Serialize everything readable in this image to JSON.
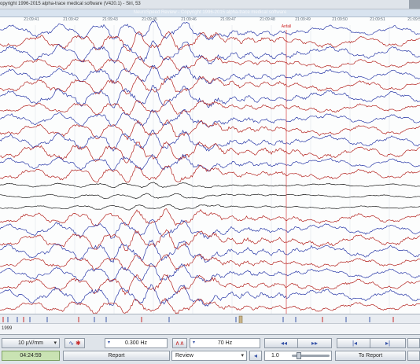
{
  "window": {
    "title": "opyright 1996-2015 alpha-trace medical software (V420.1) - Siri, 53"
  },
  "review_header": {
    "title": "NeuroSpeed Review - Copyright 1996-2015 alpha-trace medical software"
  },
  "time_axis": {
    "ticks": [
      "21:09:41",
      "21:09:42",
      "21:09:43",
      "21:09:45",
      "21:09:46",
      "21:09:47",
      "21:09:48",
      "21:09:49",
      "21:09:50",
      "21:09:51",
      "21:09:52"
    ],
    "marker_label": "Anfall"
  },
  "trace_colors": {
    "blue": "#2b3aa8",
    "red": "#b4231f",
    "black": "#1a1a1a",
    "marker": "#cc1f1f"
  },
  "channel_colors": [
    "blue",
    "red",
    "blue",
    "red",
    "blue",
    "red",
    "blue",
    "red",
    "blue",
    "red",
    "blue",
    "red",
    "blue",
    "red",
    "black",
    "black",
    "black",
    "red",
    "blue",
    "red",
    "blue",
    "red",
    "blue",
    "red",
    "blue",
    "red"
  ],
  "status": {
    "left_text": "1999"
  },
  "toolbar": {
    "sensitivity": "10 µV/mm",
    "time_display": "04:24:59",
    "low_filter": "0.300 Hz",
    "high_filter": "70 Hz",
    "report_button": "Report",
    "review_select": "Review",
    "speed_value": "1.0",
    "to_report_button": "To Report",
    "rewind_icon": "◂◂",
    "forward_icon": "▸▸",
    "first_icon": "|◂",
    "last_icon": "▸|",
    "filter_arrow": "▾"
  }
}
